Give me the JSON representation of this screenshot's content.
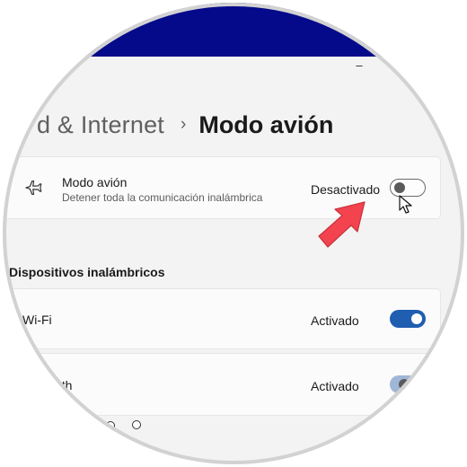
{
  "header": {
    "breadcrumb_parent": "d & Internet",
    "breadcrumb_separator": "›",
    "breadcrumb_current": "Modo avión",
    "minimize_glyph": "–"
  },
  "airplane": {
    "icon": "airplane-icon",
    "title": "Modo avión",
    "subtitle": "Detener toda la comunicación inalámbrica",
    "status": "Desactivado",
    "toggle_on": false
  },
  "wireless": {
    "section_title": "Dispositivos inalámbricos",
    "items": [
      {
        "label": "Wi-Fi",
        "status": "Activado",
        "toggle_on": true
      },
      {
        "label": "eth",
        "status": "Activado",
        "toggle_on": true
      }
    ]
  },
  "colors": {
    "title_band": "#040a8a",
    "toggle_on": "#1f5eb0",
    "annotation_arrow": "#f2434f"
  },
  "annotation": {
    "type": "arrow",
    "points_to": "airplane-toggle"
  }
}
